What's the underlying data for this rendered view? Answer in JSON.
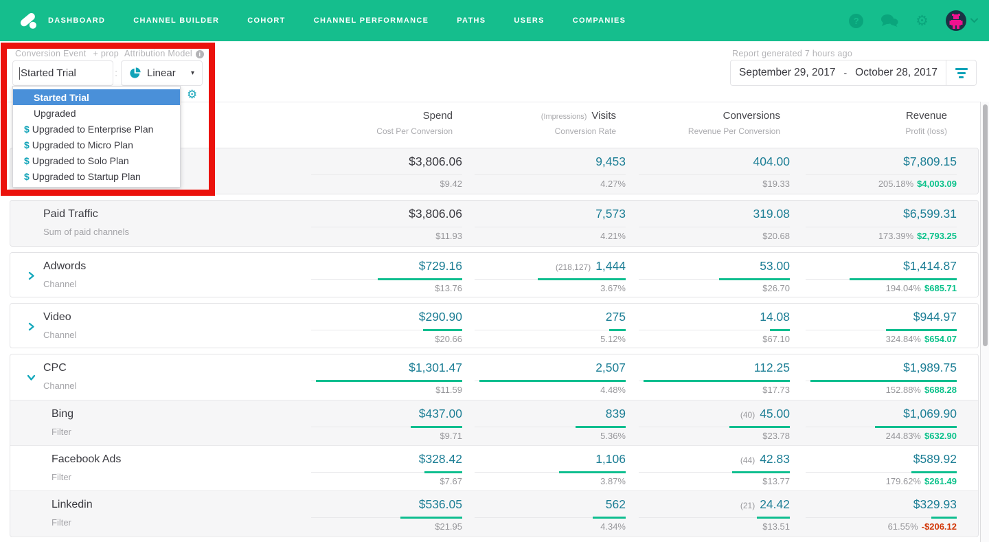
{
  "nav": {
    "items": [
      "DASHBOARD",
      "CHANNEL BUILDER",
      "COHORT",
      "CHANNEL PERFORMANCE",
      "PATHS",
      "USERS",
      "COMPANIES"
    ]
  },
  "icons": {
    "help": "?",
    "gear": "⚙",
    "info": "i",
    "caret_down": "▾",
    "colon": ":",
    "dollar": "$"
  },
  "colors": {
    "brand_green": "#15BE8D",
    "accent_teal": "#11A3B8",
    "value_teal": "#1C7E95",
    "bar_green": "#0FBE8F",
    "profit_green": "#0CC28B",
    "loss_red": "#D2390B",
    "selected_blue": "#4A90D9",
    "annotation_red": "#EB120C"
  },
  "filters": {
    "conversion_event_label": "Conversion Event",
    "conversion_event_prop": "+ prop",
    "conversion_event_value": "Started Trial",
    "attribution_model_label": "Attribution Model",
    "attribution_model_value": "Linear",
    "dropdown_options": [
      {
        "label": "Started Trial",
        "dollar": false,
        "selected": true
      },
      {
        "label": "Upgraded",
        "dollar": false,
        "selected": false
      },
      {
        "label": "Upgraded to Enterprise Plan",
        "dollar": true,
        "selected": false
      },
      {
        "label": "Upgraded to Micro Plan",
        "dollar": true,
        "selected": false
      },
      {
        "label": "Upgraded to Solo Plan",
        "dollar": true,
        "selected": false
      },
      {
        "label": "Upgraded to Startup Plan",
        "dollar": true,
        "selected": false
      }
    ]
  },
  "report": {
    "generated_label": "Report generated 7 hours ago",
    "date_start": "September 29, 2017",
    "date_separator": "-",
    "date_end": "October 28, 2017"
  },
  "table": {
    "columns": [
      {
        "title": "Spend",
        "prefix": "",
        "subtitle": "Cost Per Conversion"
      },
      {
        "title": "Visits",
        "prefix": "(Impressions)",
        "subtitle": "Conversion Rate"
      },
      {
        "title": "Conversions",
        "prefix": "",
        "subtitle": "Revenue Per Conversion"
      },
      {
        "title": "Revenue",
        "prefix": "",
        "subtitle": "Profit (loss)"
      }
    ],
    "cards": [
      {
        "bg": "gray",
        "rows": [
          {
            "name": "",
            "subtitle": "",
            "chevron": null,
            "indent": false,
            "bg": "gray",
            "cells": [
              {
                "value": "$3,806.06",
                "sub": "$9.42",
                "dark": true,
                "bar": 0
              },
              {
                "value": "9,453",
                "sub": "4.27%",
                "bar": 0
              },
              {
                "value": "404.00",
                "sub": "$19.33",
                "bar": 0
              },
              {
                "value": "$7,809.15",
                "pct": "205.18%",
                "profit": "$4,003.09",
                "negative": false,
                "bar": 0
              }
            ]
          }
        ]
      },
      {
        "bg": "gray",
        "rows": [
          {
            "name": "Paid Traffic",
            "subtitle": "Sum of paid channels",
            "chevron": null,
            "indent": false,
            "bg": "gray",
            "cells": [
              {
                "value": "$3,806.06",
                "sub": "$11.93",
                "dark": true,
                "bar": 0
              },
              {
                "value": "7,573",
                "sub": "4.21%",
                "bar": 0
              },
              {
                "value": "319.08",
                "sub": "$20.68",
                "bar": 0
              },
              {
                "value": "$6,599.31",
                "pct": "173.39%",
                "profit": "$2,793.25",
                "negative": false,
                "bar": 0
              }
            ]
          }
        ]
      },
      {
        "bg": "white",
        "rows": [
          {
            "name": "Adwords",
            "subtitle": "Channel",
            "chevron": "right",
            "indent": false,
            "bg": "white",
            "cells": [
              {
                "value": "$729.16",
                "sub": "$13.76",
                "bar": 0.56
              },
              {
                "value": "1,444",
                "paren": "(218,127)",
                "sub": "3.67%",
                "bar": 0.58
              },
              {
                "value": "53.00",
                "sub": "$26.70",
                "bar": 0.47
              },
              {
                "value": "$1,414.87",
                "pct": "194.04%",
                "profit": "$685.71",
                "negative": false,
                "bar": 0.71
              }
            ]
          }
        ]
      },
      {
        "bg": "white",
        "rows": [
          {
            "name": "Video",
            "subtitle": "Channel",
            "chevron": "right",
            "indent": false,
            "bg": "white",
            "cells": [
              {
                "value": "$290.90",
                "sub": "$20.66",
                "bar": 0.26
              },
              {
                "value": "275",
                "sub": "5.12%",
                "bar": 0.11
              },
              {
                "value": "14.08",
                "sub": "$67.10",
                "bar": 0.13
              },
              {
                "value": "$944.97",
                "pct": "324.84%",
                "profit": "$654.07",
                "negative": false,
                "bar": 0.47
              }
            ]
          }
        ]
      },
      {
        "bg": "white",
        "rows": [
          {
            "name": "CPC",
            "subtitle": "Channel",
            "chevron": "down",
            "indent": false,
            "bg": "white",
            "cells": [
              {
                "value": "$1,301.47",
                "sub": "$11.59",
                "bar": 0.97
              },
              {
                "value": "2,507",
                "sub": "4.48%",
                "bar": 0.97
              },
              {
                "value": "112.25",
                "sub": "$17.73",
                "bar": 0.97
              },
              {
                "value": "$1,989.75",
                "pct": "152.88%",
                "profit": "$688.28",
                "negative": false,
                "bar": 0.97
              }
            ]
          },
          {
            "name": "Bing",
            "subtitle": "Filter",
            "chevron": null,
            "indent": true,
            "bg": "gray",
            "cells": [
              {
                "value": "$437.00",
                "sub": "$9.71",
                "bar": 0.34
              },
              {
                "value": "839",
                "sub": "5.36%",
                "bar": 0.33
              },
              {
                "value": "45.00",
                "paren": "(40)",
                "sub": "$23.78",
                "bar": 0.4
              },
              {
                "value": "$1,069.90",
                "pct": "244.83%",
                "profit": "$632.90",
                "negative": false,
                "bar": 0.54
              }
            ]
          },
          {
            "name": "Facebook Ads",
            "subtitle": "Filter",
            "chevron": null,
            "indent": true,
            "bg": "white",
            "cells": [
              {
                "value": "$328.42",
                "sub": "$7.67",
                "bar": 0.25
              },
              {
                "value": "1,106",
                "sub": "3.87%",
                "bar": 0.44
              },
              {
                "value": "42.83",
                "paren": "(44)",
                "sub": "$13.77",
                "bar": 0.38
              },
              {
                "value": "$589.92",
                "pct": "179.62%",
                "profit": "$261.49",
                "negative": false,
                "bar": 0.3
              }
            ]
          },
          {
            "name": "Linkedin",
            "subtitle": "Filter",
            "chevron": null,
            "indent": true,
            "bg": "gray",
            "cells": [
              {
                "value": "$536.05",
                "sub": "$21.95",
                "bar": 0.41
              },
              {
                "value": "562",
                "sub": "4.34%",
                "bar": 0.22
              },
              {
                "value": "24.42",
                "paren": "(21)",
                "sub": "$13.51",
                "bar": 0.22
              },
              {
                "value": "$329.93",
                "pct": "61.55%",
                "profit": "-$206.12",
                "negative": true,
                "bar": 0.17
              }
            ]
          }
        ]
      }
    ]
  }
}
